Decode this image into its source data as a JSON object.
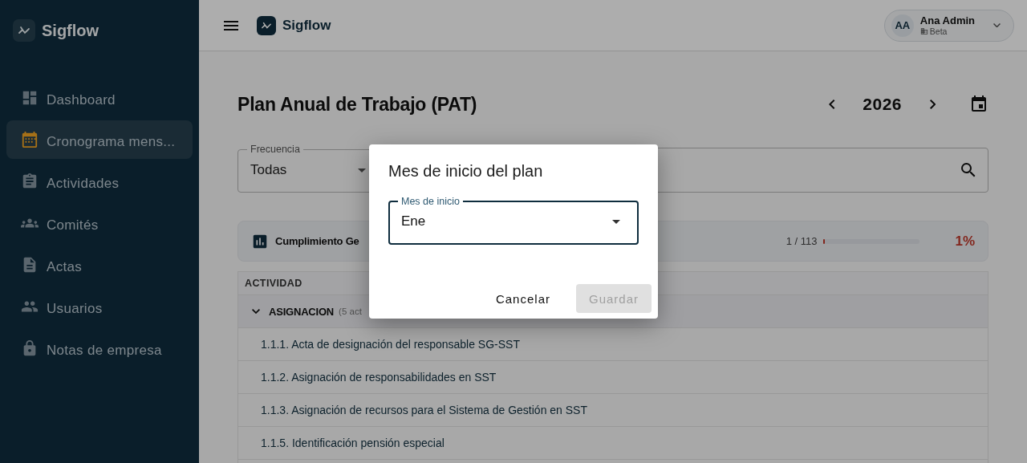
{
  "sidebar": {
    "brand": "Sigflow",
    "items": [
      {
        "label": "Dashboard",
        "selected": false
      },
      {
        "label": "Cronograma mens...",
        "selected": true
      },
      {
        "label": "Actividades",
        "selected": false
      },
      {
        "label": "Comités",
        "selected": false
      },
      {
        "label": "Actas",
        "selected": false
      },
      {
        "label": "Usuarios",
        "selected": false
      },
      {
        "label": "Notas de empresa",
        "selected": false
      }
    ]
  },
  "header": {
    "brand": "Sigflow",
    "user": {
      "initials": "AA",
      "name": "Ana Admin",
      "company": "Beta"
    }
  },
  "page": {
    "title": "Plan Anual de Trabajo (PAT)",
    "year": "2026",
    "frequency": {
      "label": "Frecuencia",
      "value": "Todas"
    },
    "progress": {
      "label": "Cumplimiento Ge",
      "count": "1 / 113",
      "level": 0.01,
      "percent": "1%"
    },
    "table": {
      "column": "ACTIVIDAD",
      "groups": [
        {
          "name": "ASIGNACION",
          "count": "(5 act",
          "expanded": true,
          "rows": [
            "1.1.1. Acta de designación del responsable SG-SST",
            "1.1.2. Asignación de responsabilidades en SST",
            "1.1.3. Asignación de recursos para el Sistema de Gestión en SST",
            "1.1.5. Identificación pensión especial"
          ]
        }
      ]
    }
  },
  "dialog": {
    "title": "Mes de inicio del plan",
    "field": {
      "label": "Mes de inicio",
      "value": "Ene"
    },
    "buttons": [
      {
        "label": "Cancelar",
        "kind": "text",
        "disabled": false
      },
      {
        "label": "Guardar",
        "kind": "contained",
        "disabled": true
      }
    ]
  }
}
